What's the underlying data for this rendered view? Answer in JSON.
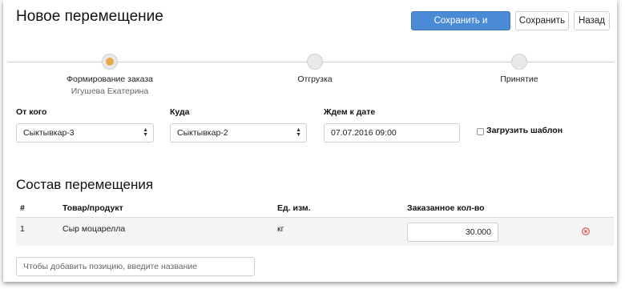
{
  "header": {
    "title": "Новое перемещение",
    "save_send_label": "Сохранить и отправить",
    "save_label": "Сохранить",
    "back_label": "Назад"
  },
  "steps": [
    {
      "label": "Формирование заказа",
      "sub": "Игушева Екатерина",
      "active": true
    },
    {
      "label": "Отгрузка",
      "sub": "",
      "active": false
    },
    {
      "label": "Принятие",
      "sub": "",
      "active": false
    }
  ],
  "form": {
    "from_label": "От кого",
    "from_value": "Сыктывкар-3",
    "to_label": "Куда",
    "to_value": "Сыктывкар-2",
    "date_label": "Ждем к дате",
    "date_value": "07.07.2016 09:00",
    "template_label": "Загрузить шаблон",
    "template_checked": false
  },
  "items_section": {
    "title": "Состав перемещения",
    "columns": [
      "#",
      "Товар/продукт",
      "Ед. изм.",
      "Заказанное кол-во"
    ],
    "rows": [
      {
        "num": "1",
        "product": "Сыр моцарелла",
        "unit": "кг",
        "qty": "30.000"
      }
    ],
    "add_placeholder": "Чтобы добавить позицию, введите название"
  },
  "colors": {
    "primary": "#4b8bd6",
    "active_step": "#e8a94a",
    "remove": "#d9534f"
  }
}
